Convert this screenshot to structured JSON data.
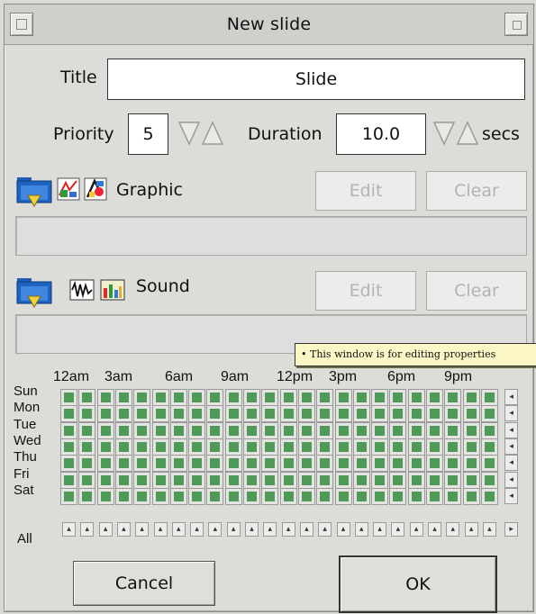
{
  "window": {
    "title": "New slide"
  },
  "form": {
    "title_label": "Title",
    "title_value": "Slide",
    "priority_label": "Priority",
    "priority_value": "5",
    "duration_label": "Duration",
    "duration_value": "10.0",
    "duration_unit": "secs"
  },
  "graphic": {
    "label": "Graphic",
    "edit_label": "Edit",
    "clear_label": "Clear",
    "path": ""
  },
  "sound": {
    "label": "Sound",
    "edit_label": "Edit",
    "clear_label": "Clear",
    "path": ""
  },
  "tooltip": {
    "text": "• This window is for editing properties"
  },
  "schedule": {
    "hour_labels": [
      "12am",
      "3am",
      "6am",
      "9am",
      "12pm",
      "3pm",
      "6pm",
      "9pm"
    ],
    "days": [
      "Sun",
      "Mon",
      "Tue",
      "Wed",
      "Thu",
      "Fri",
      "Sat"
    ],
    "all_label": "All",
    "all_selected": true
  },
  "actions": {
    "cancel_label": "Cancel",
    "ok_label": "OK"
  },
  "colors": {
    "cell_on": "#4f9a56",
    "tooltip_bg": "#fbf6c6"
  }
}
